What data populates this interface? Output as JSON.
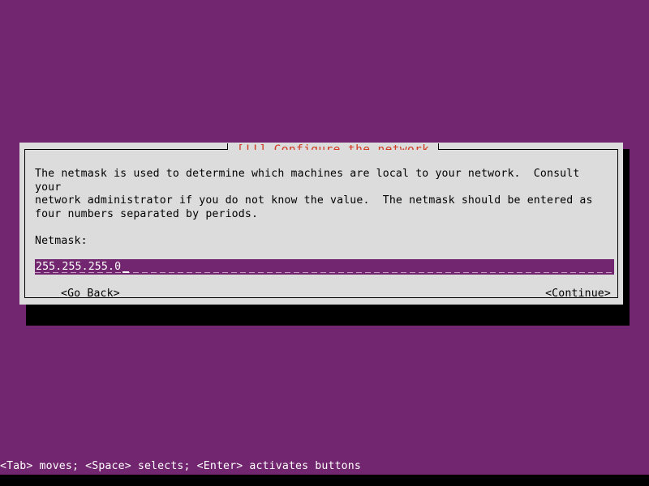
{
  "screen": {
    "background_color": "#72266f",
    "bottom_strip_color": "#000000"
  },
  "dialog": {
    "title": "[!!] Configure the network",
    "title_color": "#cf3a21",
    "background_color": "#dcdcdc",
    "border_color": "#000000",
    "shadow_color": "#000000",
    "description": "The netmask is used to determine which machines are local to your network.  Consult your\nnetwork administrator if you do not know the value.  The netmask should be entered as\nfour numbers separated by periods.",
    "field": {
      "label": "Netmask:",
      "value": "255.255.255.0",
      "placeholder": "",
      "field_background_color": "#72266f",
      "field_text_color": "#ffffff",
      "underline_color": "#c89ac4"
    },
    "buttons": {
      "go_back": "<Go Back>",
      "continue": "<Continue>"
    }
  },
  "status_bar": {
    "hint": "<Tab> moves; <Space> selects; <Enter> activates buttons",
    "text_color": "#ffffff"
  }
}
